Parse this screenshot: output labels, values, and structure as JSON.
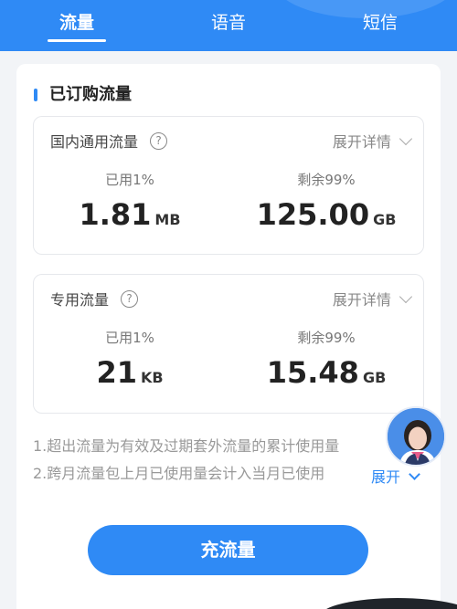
{
  "tabs": {
    "flow": "流量",
    "voice": "语音",
    "sms": "短信"
  },
  "section": {
    "title": "已订购流量"
  },
  "cards": [
    {
      "name": "国内通用流量",
      "help_icon": "?",
      "expand": "展开详情",
      "used_label": "已用1%",
      "used_value": "1.81",
      "used_unit": "MB",
      "left_label": "剩余99%",
      "left_value": "125.00",
      "left_unit": "GB"
    },
    {
      "name": "专用流量",
      "help_icon": "?",
      "expand": "展开详情",
      "used_label": "已用1%",
      "used_value": "21",
      "used_unit": "KB",
      "left_label": "剩余99%",
      "left_value": "15.48",
      "left_unit": "GB"
    }
  ],
  "notes": [
    "1.超出流量为有效及过期套外流量的累计使用量",
    "2.跨月流量包上月已使用量会计入当月已使用"
  ],
  "notes_expand": "展开",
  "recharge_button": "充流量",
  "colors": {
    "accent": "#2f8af5"
  }
}
